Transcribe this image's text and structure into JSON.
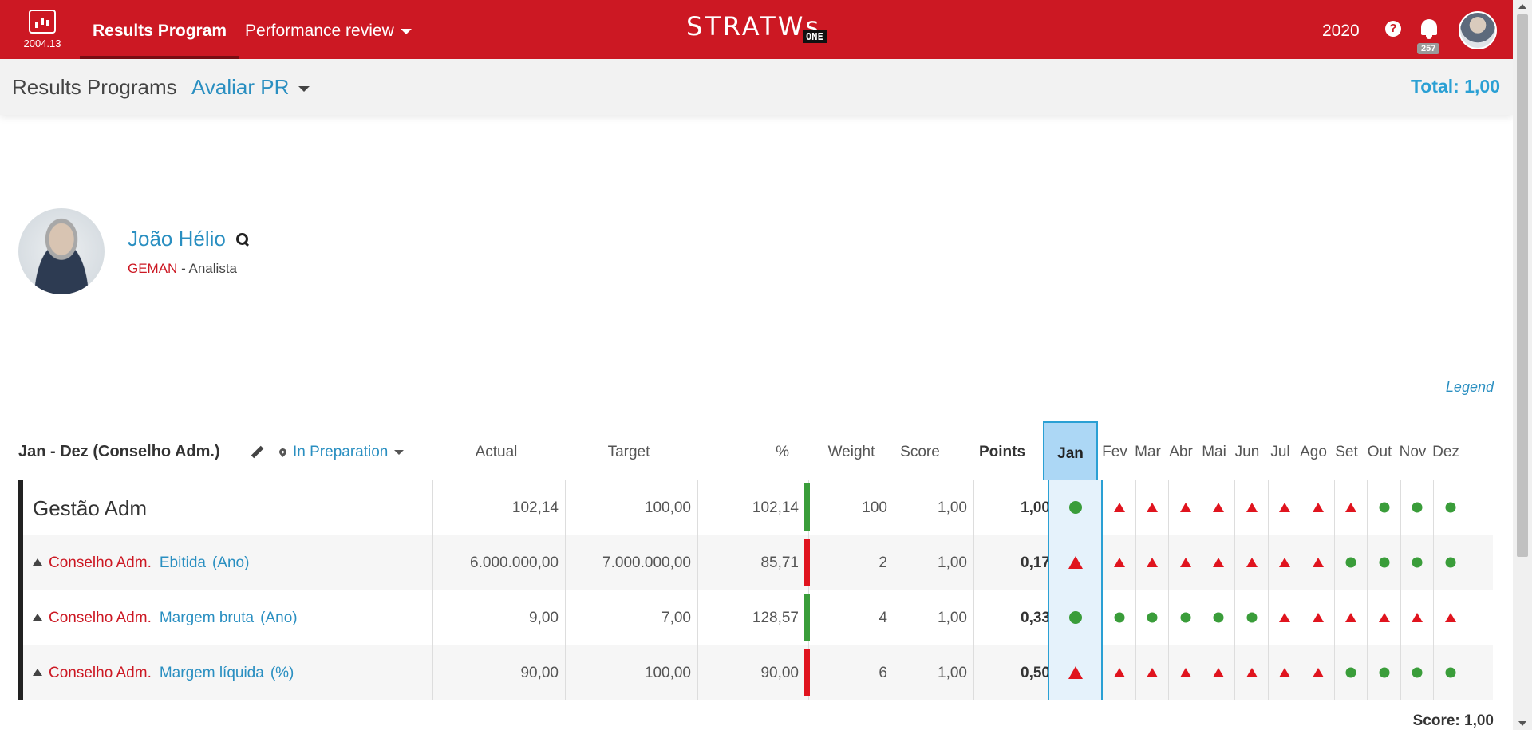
{
  "topbar": {
    "version": "2004.13",
    "nav_active": "Results Program",
    "nav_dropdown": "Performance review",
    "logo_text": "STRATWs",
    "logo_badge": "ONE",
    "year": "2020",
    "help_icon": "question-circle-icon",
    "notifications_count": "257"
  },
  "subheader": {
    "title": "Results Programs",
    "dropdown": "Avaliar PR",
    "total": "Total: 1,00"
  },
  "profile": {
    "name": "João Hélio",
    "org": "GEMAN",
    "separator": " - ",
    "role": "Analista"
  },
  "legend_label": "Legend",
  "table": {
    "period": "Jan - Dez (Conselho Adm.)",
    "status": "In Preparation",
    "headers": {
      "actual": "Actual",
      "target": "Target",
      "pct": "%",
      "weight": "Weight",
      "score": "Score",
      "points": "Points"
    },
    "months": [
      "Jan",
      "Fev",
      "Mar",
      "Abr",
      "Mai",
      "Jun",
      "Jul",
      "Ago",
      "Set",
      "Out",
      "Nov",
      "Dez"
    ],
    "group": {
      "name": "Gestão Adm",
      "actual": "102,14",
      "target": "100,00",
      "pct": "102,14",
      "weight": "100",
      "score": "1,00",
      "points": "1,00",
      "bar": "green",
      "months": [
        "g",
        "r",
        "r",
        "r",
        "r",
        "r",
        "r",
        "r",
        "r",
        "g",
        "g",
        "g"
      ]
    },
    "rows": [
      {
        "org": "Conselho Adm.",
        "kpi": "Ebitida",
        "unit": "(Ano)",
        "actual": "6.000.000,00",
        "target": "7.000.000,00",
        "pct": "85,71",
        "weight": "2",
        "score": "1,00",
        "points": "0,17",
        "bar": "red",
        "months": [
          "r",
          "r",
          "r",
          "r",
          "r",
          "r",
          "r",
          "r",
          "g",
          "g",
          "g",
          "g"
        ]
      },
      {
        "org": "Conselho Adm.",
        "kpi": "Margem bruta",
        "unit": "(Ano)",
        "actual": "9,00",
        "target": "7,00",
        "pct": "128,57",
        "weight": "4",
        "score": "1,00",
        "points": "0,33",
        "bar": "green",
        "months": [
          "g",
          "g",
          "g",
          "g",
          "g",
          "g",
          "r",
          "r",
          "r",
          "r",
          "r",
          "r"
        ]
      },
      {
        "org": "Conselho Adm.",
        "kpi": "Margem líquida",
        "unit": "(%)",
        "actual": "90,00",
        "target": "100,00",
        "pct": "90,00",
        "weight": "6",
        "score": "1,00",
        "points": "0,50",
        "bar": "red",
        "months": [
          "r",
          "r",
          "r",
          "r",
          "r",
          "r",
          "r",
          "r",
          "g",
          "g",
          "g",
          "g"
        ]
      }
    ],
    "footer_score": "Score: 1,00"
  },
  "colors": {
    "brand": "#cc1823",
    "link": "#2a8fc1",
    "good": "#3a9d3a",
    "bad": "#e0141e"
  }
}
